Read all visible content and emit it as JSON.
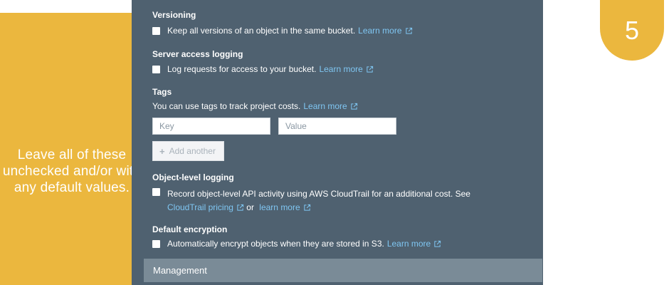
{
  "callout": {
    "text": "Leave all of these unchecked and/or with any default values.",
    "color": "#ebb73e"
  },
  "step": {
    "number": "5"
  },
  "panel": {
    "versioning": {
      "title": "Versioning",
      "label": "Keep all versions of an object in the same bucket.",
      "link": "Learn more",
      "checked": false
    },
    "server_access_logging": {
      "title": "Server access logging",
      "label": "Log requests for access to your bucket.",
      "link": "Learn more",
      "checked": false
    },
    "tags": {
      "title": "Tags",
      "description": "You can use tags to track project costs.",
      "link": "Learn more",
      "key_placeholder": "Key",
      "value_placeholder": "Value",
      "add_button": "Add another"
    },
    "object_level_logging": {
      "title": "Object-level logging",
      "label": "Record object-level API activity using AWS CloudTrail for an additional cost. See",
      "pricing_link": "CloudTrail pricing",
      "or_text": "or",
      "link": "learn more",
      "checked": false
    },
    "default_encryption": {
      "title": "Default encryption",
      "label": "Automatically encrypt objects when they are stored in S3.",
      "link": "Learn more",
      "checked": false
    },
    "management": {
      "label": "Management"
    },
    "colors": {
      "panel": "#4f6170",
      "link": "#7fc6f2",
      "management_bar": "#7a8b97"
    }
  }
}
